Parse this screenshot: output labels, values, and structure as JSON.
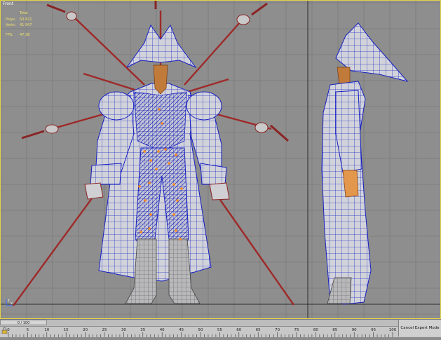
{
  "viewport": {
    "label": "Front",
    "stats": {
      "total_label": "Total",
      "polys_label": "Polys:",
      "polys_value": "50 821",
      "verts_label": "Verts:",
      "verts_value": "41 947",
      "fps_label": "FPS:",
      "fps_value": "47.38"
    }
  },
  "timeline": {
    "frame_indicator": "0 / 100",
    "ticks": [
      "0",
      "5",
      "10",
      "15",
      "20",
      "25",
      "30",
      "35",
      "40",
      "45",
      "50",
      "55",
      "60",
      "65",
      "70",
      "75",
      "80",
      "85",
      "90",
      "95",
      "100"
    ]
  },
  "toolbar": {
    "expert_mode_button": "Cancel Expert Mode"
  },
  "colors": {
    "viewport_bg": "#8e8e8e",
    "grid_line": "#7d7d7d",
    "wire_blue": "#1c22c8",
    "mesh_gray": "#cfcfd4",
    "sword_red": "#a23030",
    "orange_points": "#ff8a1c",
    "stats_yellow": "#f0e26a"
  },
  "icons": [
    "axis-gizmo-icon",
    "lock-icon"
  ]
}
